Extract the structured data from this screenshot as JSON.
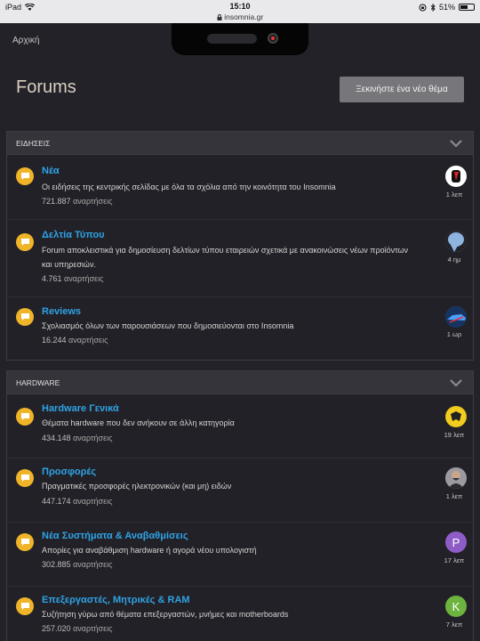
{
  "status_bar": {
    "device": "iPad",
    "time": "15:10",
    "url": "insomnia.gr",
    "battery": "51%"
  },
  "breadcrumb": "Αρχική",
  "page_title": "Forums",
  "new_topic_button": "Ξεκινήστε ένα νέο θέμα",
  "sections": [
    {
      "title": "ΕΙΔΗΣΕΙΣ",
      "forums": [
        {
          "title": "Νέα",
          "desc": "Οι ειδήσεις της κεντρικής σελίδας με όλα τα σχόλια από την κοινότητα του Insomnia",
          "count": "721.887",
          "count_label": "αναρτήσεις",
          "ago": "1 λεπ",
          "avatar": "red-logo"
        },
        {
          "title": "Δελτία Τύπου",
          "desc": "Forum αποκλειστικά για δημοσίευση δελτίων τύπου εταιρειών σχετικά με ανακοινώσεις νέων προϊόντων και υπηρεσιών.",
          "count": "4.761",
          "count_label": "αναρτήσεις",
          "ago": "4 ημ",
          "avatar": "blue-cloud"
        },
        {
          "title": "Reviews",
          "desc": "Σχολιασμός όλων των παρουσιάσεων που δημοσιεύονται στο Insomnia",
          "count": "16.244",
          "count_label": "αναρτήσεις",
          "ago": "1 ωρ",
          "avatar": "blue-car"
        }
      ]
    },
    {
      "title": "HARDWARE",
      "forums": [
        {
          "title": "Hardware Γενικά",
          "desc": "Θέματα hardware που δεν ανήκουν σε άλλη κατηγορία",
          "count": "434.148",
          "count_label": "αναρτήσεις",
          "ago": "19 λεπ",
          "avatar": "yellow-emblem"
        },
        {
          "title": "Προσφορές",
          "desc": "Πραγματικές προσφορές ηλεκτρονικών (και μη) ειδών",
          "count": "447.174",
          "count_label": "αναρτήσεις",
          "ago": "1 λεπ",
          "avatar": "person-photo"
        },
        {
          "title": "Νέα Συστήματα & Αναβαθμίσεις",
          "desc": "Απορίες για αναβάθμιση hardware ή αγορά νέου υπολογιστή",
          "count": "302.885",
          "count_label": "αναρτήσεις",
          "ago": "17 λεπ",
          "avatar_letter": "P",
          "avatar_color": "#8e5cc7"
        },
        {
          "title": "Επεξεργαστές, Μητρικές & RAM",
          "desc": "Συζήτηση γύρω από θέματα επεξεργαστών, μνήμες και motherboards",
          "count": "257.020",
          "count_label": "αναρτήσεις",
          "ago": "7 λεπ",
          "avatar_letter": "K",
          "avatar_color": "#6db33f"
        }
      ]
    }
  ],
  "colors": {
    "accent": "#2fa3e6",
    "bubble": "#f0b429",
    "background": "#232228"
  }
}
